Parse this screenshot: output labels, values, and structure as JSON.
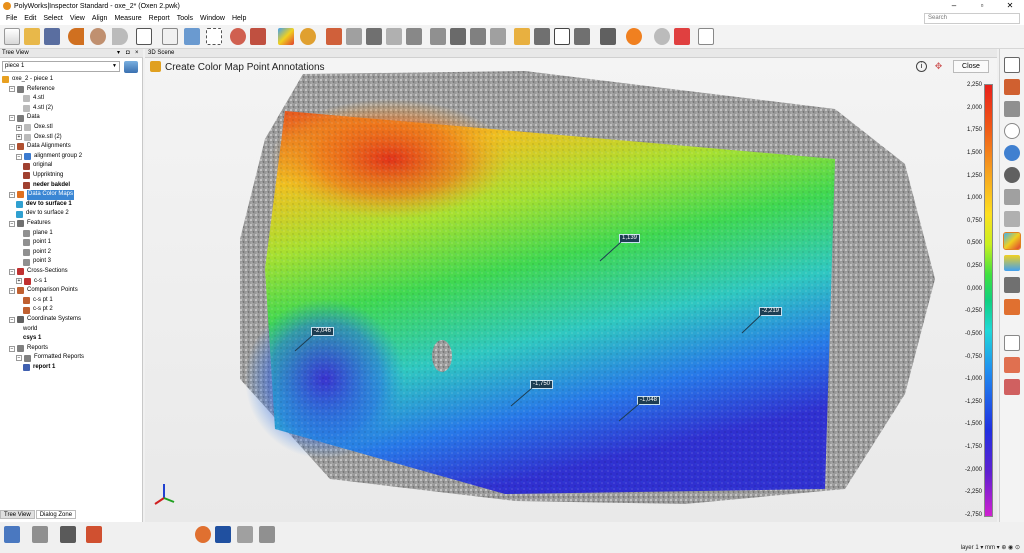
{
  "window": {
    "title": "PolyWorks|Inspector Standard - oxe_2* (Oxen 2.pwk)"
  },
  "menu": [
    "File",
    "Edit",
    "Select",
    "View",
    "Align",
    "Measure",
    "Report",
    "Tools",
    "Window",
    "Help"
  ],
  "search": {
    "placeholder": "Search"
  },
  "tree_view": {
    "title": "Tree View",
    "piece_select": "piece 1",
    "items": [
      {
        "label": "oxe_2 - piece 1",
        "indent": 0,
        "exp": "",
        "icon": "#e8a020",
        "style": ""
      },
      {
        "label": "Reference",
        "indent": 1,
        "exp": "−",
        "icon": "#7a7a7a",
        "style": ""
      },
      {
        "label": "4.stl",
        "indent": 3,
        "exp": "",
        "icon": "#bbbbbb",
        "style": ""
      },
      {
        "label": "4.stl (2)",
        "indent": 3,
        "exp": "",
        "icon": "#bbbbbb",
        "style": ""
      },
      {
        "label": "Data",
        "indent": 1,
        "exp": "−",
        "icon": "#7a7a7a",
        "style": ""
      },
      {
        "label": "Oxe.stl",
        "indent": 2,
        "exp": "+",
        "icon": "#bbbbbb",
        "style": ""
      },
      {
        "label": "Oxe.stl (2)",
        "indent": 2,
        "exp": "+",
        "icon": "#bbbbbb",
        "style": ""
      },
      {
        "label": "Data Alignments",
        "indent": 1,
        "exp": "−",
        "icon": "#b05030",
        "style": ""
      },
      {
        "label": "alignment group 2",
        "indent": 2,
        "exp": "−",
        "icon": "#3a7ad0",
        "style": ""
      },
      {
        "label": "original",
        "indent": 3,
        "exp": "",
        "icon": "#a04030",
        "style": ""
      },
      {
        "label": "Uppriktning",
        "indent": 3,
        "exp": "",
        "icon": "#a04030",
        "style": ""
      },
      {
        "label": "neder bakdel",
        "indent": 3,
        "exp": "",
        "icon": "#a04030",
        "style": "bold"
      },
      {
        "label": "Data Color Maps",
        "indent": 1,
        "exp": "−",
        "icon": "#e07020",
        "style": "sel"
      },
      {
        "label": "dev to surface 1",
        "indent": 2,
        "exp": "",
        "icon": "#30a0d0",
        "style": "bold"
      },
      {
        "label": "dev to surface 2",
        "indent": 2,
        "exp": "",
        "icon": "#30a0d0",
        "style": ""
      },
      {
        "label": "Features",
        "indent": 1,
        "exp": "−",
        "icon": "#707070",
        "style": ""
      },
      {
        "label": "plane 1",
        "indent": 3,
        "exp": "",
        "icon": "#909090",
        "style": ""
      },
      {
        "label": "point 1",
        "indent": 3,
        "exp": "",
        "icon": "#909090",
        "style": ""
      },
      {
        "label": "point 2",
        "indent": 3,
        "exp": "",
        "icon": "#909090",
        "style": ""
      },
      {
        "label": "point 3",
        "indent": 3,
        "exp": "",
        "icon": "#909090",
        "style": ""
      },
      {
        "label": "Cross-Sections",
        "indent": 1,
        "exp": "−",
        "icon": "#c03030",
        "style": ""
      },
      {
        "label": "c-s 1",
        "indent": 2,
        "exp": "+",
        "icon": "#c03030",
        "style": ""
      },
      {
        "label": "Comparison Points",
        "indent": 1,
        "exp": "−",
        "icon": "#c06030",
        "style": ""
      },
      {
        "label": "c-s pt 1",
        "indent": 3,
        "exp": "",
        "icon": "#c06030",
        "style": ""
      },
      {
        "label": "c-s pt 2",
        "indent": 3,
        "exp": "",
        "icon": "#c06030",
        "style": ""
      },
      {
        "label": "Coordinate Systems",
        "indent": 1,
        "exp": "−",
        "icon": "#606060",
        "style": ""
      },
      {
        "label": "world",
        "indent": 3,
        "exp": "",
        "icon": "",
        "style": ""
      },
      {
        "label": "csys 1",
        "indent": 3,
        "exp": "",
        "icon": "",
        "style": "bold"
      },
      {
        "label": "Reports",
        "indent": 1,
        "exp": "−",
        "icon": "#808080",
        "style": ""
      },
      {
        "label": "Formatted Reports",
        "indent": 2,
        "exp": "−",
        "icon": "#808080",
        "style": ""
      },
      {
        "label": "report 1",
        "indent": 3,
        "exp": "",
        "icon": "#4060b0",
        "style": "bold"
      }
    ]
  },
  "bottom_tabs": [
    "Tree View",
    "Dialog Zone"
  ],
  "scene": {
    "title": "3D Scene",
    "panel_title": "Create Color Map Point Annotations",
    "close_label": "Close",
    "annotations": [
      "1,139",
      "-2,046",
      "-2,219",
      "-1,750",
      "-1,048"
    ]
  },
  "scale": {
    "ticks": [
      "2,250",
      "2,000",
      "1,750",
      "1,500",
      "1,250",
      "1,000",
      "0,750",
      "0,500",
      "0,250",
      "0,000",
      "-0,250",
      "-0,500",
      "-0,750",
      "-1,000",
      "-1,250",
      "-1,500",
      "-1,750",
      "-2,000",
      "-2,250",
      "-2,750"
    ]
  },
  "status": {
    "layer": "layer 1",
    "unit": "mm"
  },
  "colors": {
    "selection": "#3a86d4",
    "accent_orange": "#e07020"
  }
}
